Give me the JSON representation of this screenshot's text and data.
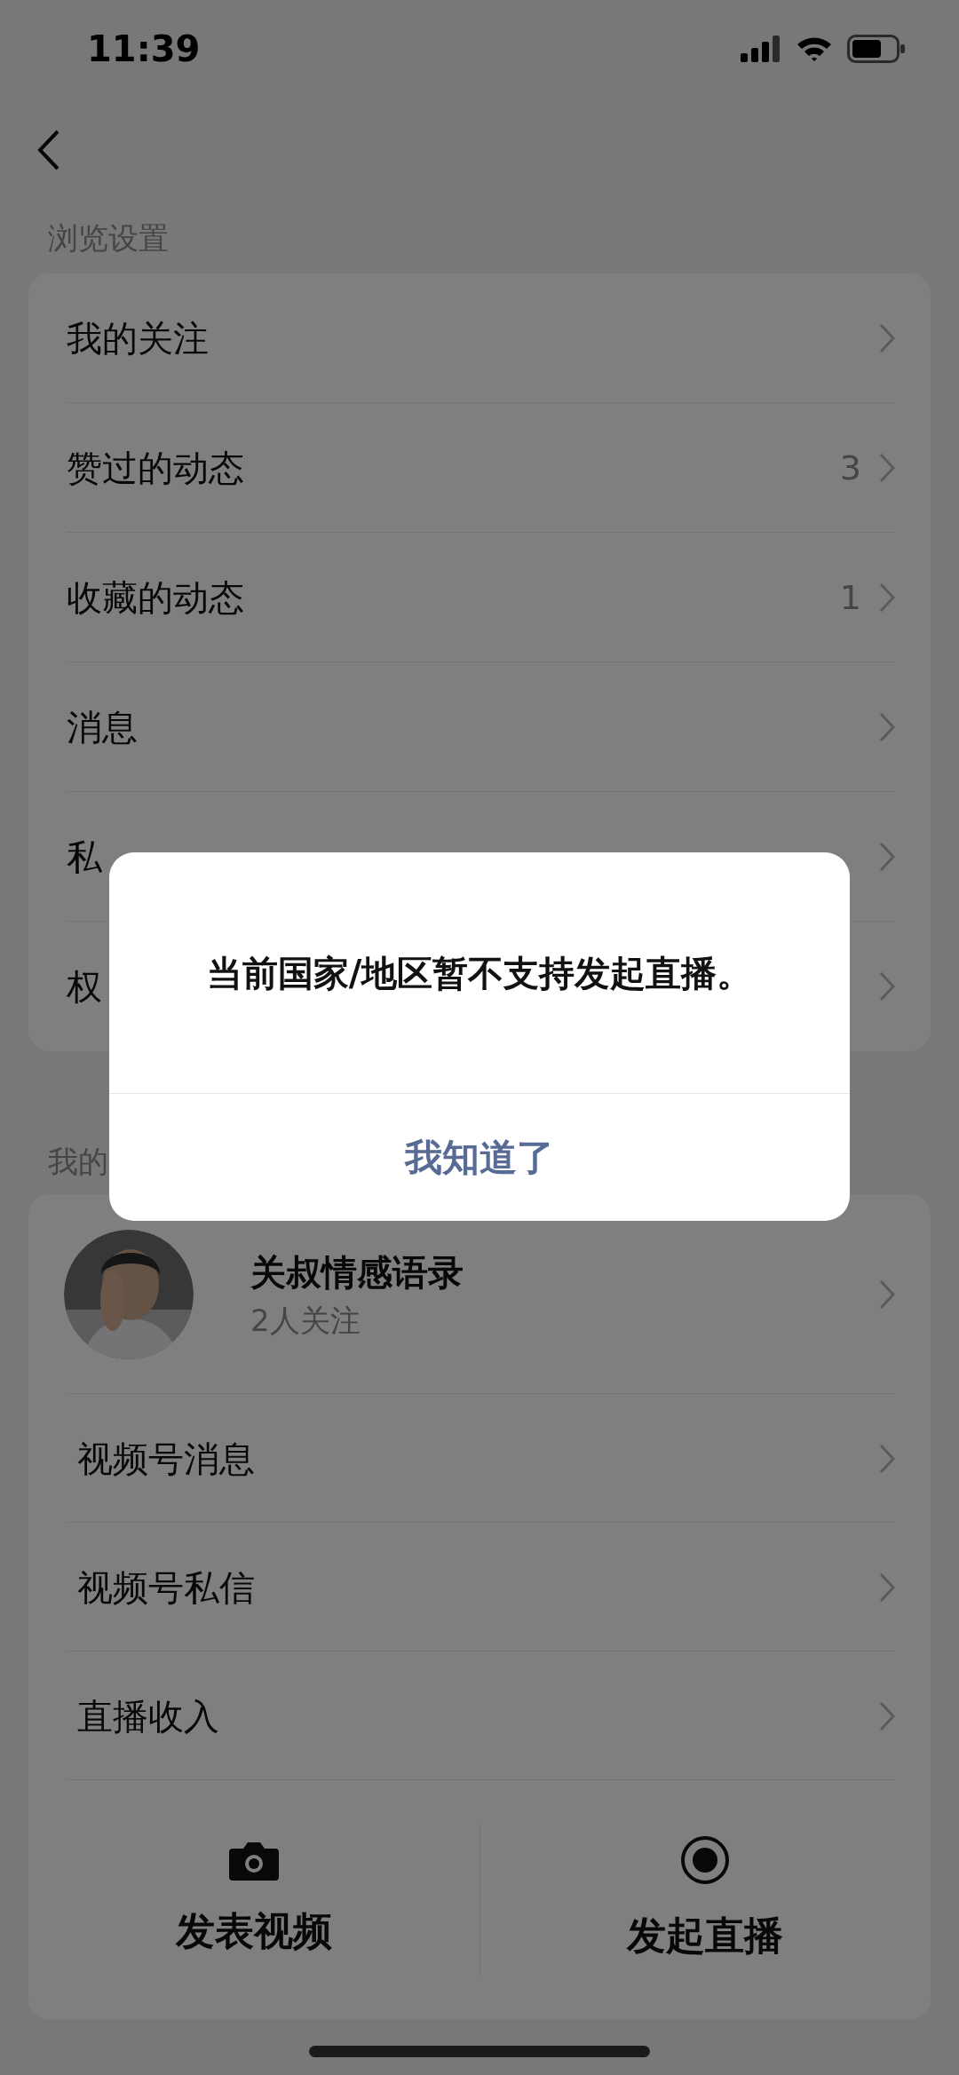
{
  "status_bar": {
    "time": "11:39"
  },
  "browse_section": {
    "title": "浏览设置",
    "items": [
      {
        "label": "我的关注"
      },
      {
        "label": "赞过的动态",
        "count": "3"
      },
      {
        "label": "收藏的动态",
        "count": "1"
      },
      {
        "label": "消息"
      },
      {
        "label": "私"
      },
      {
        "label": "权"
      }
    ]
  },
  "channel_section": {
    "title": "我的",
    "profile": {
      "name": "关叔情感语录",
      "followers": "2人关注"
    },
    "items": [
      {
        "label": "视频号消息"
      },
      {
        "label": "视频号私信"
      },
      {
        "label": "直播收入"
      }
    ],
    "actions": [
      {
        "kind": "camera",
        "label": "发表视频"
      },
      {
        "kind": "record",
        "label": "发起直播"
      }
    ]
  },
  "dialog": {
    "message": "当前国家/地区暂不支持发起直播。",
    "button": "我知道了"
  }
}
